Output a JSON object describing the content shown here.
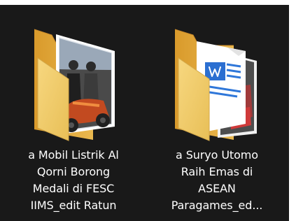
{
  "explorer": {
    "items": [
      {
        "name": "a Mobil Listrik Al\nQorni Borong\nMedali di FESC\nIIMS_edit Ratun",
        "icon": "folder-with-photo-icon"
      },
      {
        "name": "a Suryo Utomo\nRaih Emas di\nASEAN\nParagames_ed...",
        "icon": "folder-with-document-icon"
      }
    ],
    "colors": {
      "background": "#191919",
      "folder_back": "#e7b24a",
      "folder_front": "#f7d77f",
      "label_text": "#ffffff"
    }
  }
}
